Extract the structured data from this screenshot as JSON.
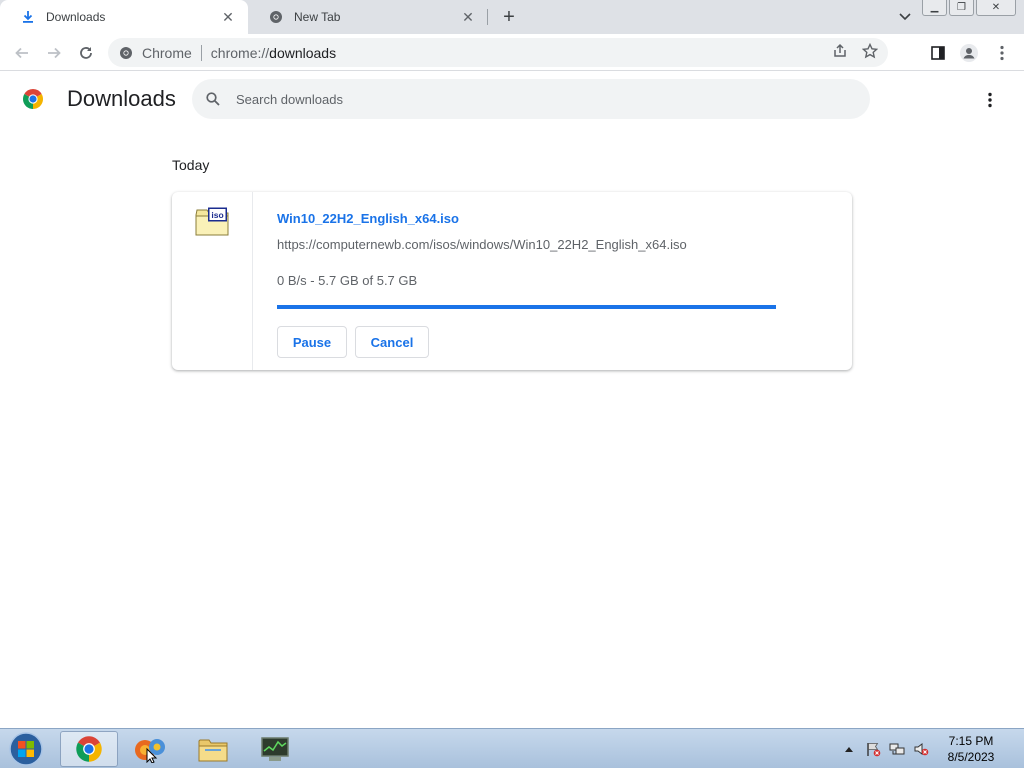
{
  "tabs": [
    {
      "title": "Downloads",
      "active": true,
      "icon": "download-icon"
    },
    {
      "title": "New Tab",
      "active": false,
      "icon": "chrome-icon"
    }
  ],
  "omnibox": {
    "scheme_label": "Chrome",
    "url_prefix": "chrome://",
    "url_host": "downloads"
  },
  "downloads": {
    "title": "Downloads",
    "search_placeholder": "Search downloads",
    "section_date": "Today",
    "items": [
      {
        "file_name": "Win10_22H2_English_x64.iso",
        "file_icon_label": "iso",
        "url": "https://computernewb.com/isos/windows/Win10_22H2_English_x64.iso",
        "status": "0 B/s - 5.7 GB of 5.7 GB",
        "progress_percent": 100,
        "pause_label": "Pause",
        "cancel_label": "Cancel"
      }
    ]
  },
  "taskbar": {
    "clock_time": "7:15 PM",
    "clock_date": "8/5/2023"
  },
  "colors": {
    "accent": "#1a73e8",
    "tabstrip": "#dee1e6"
  }
}
